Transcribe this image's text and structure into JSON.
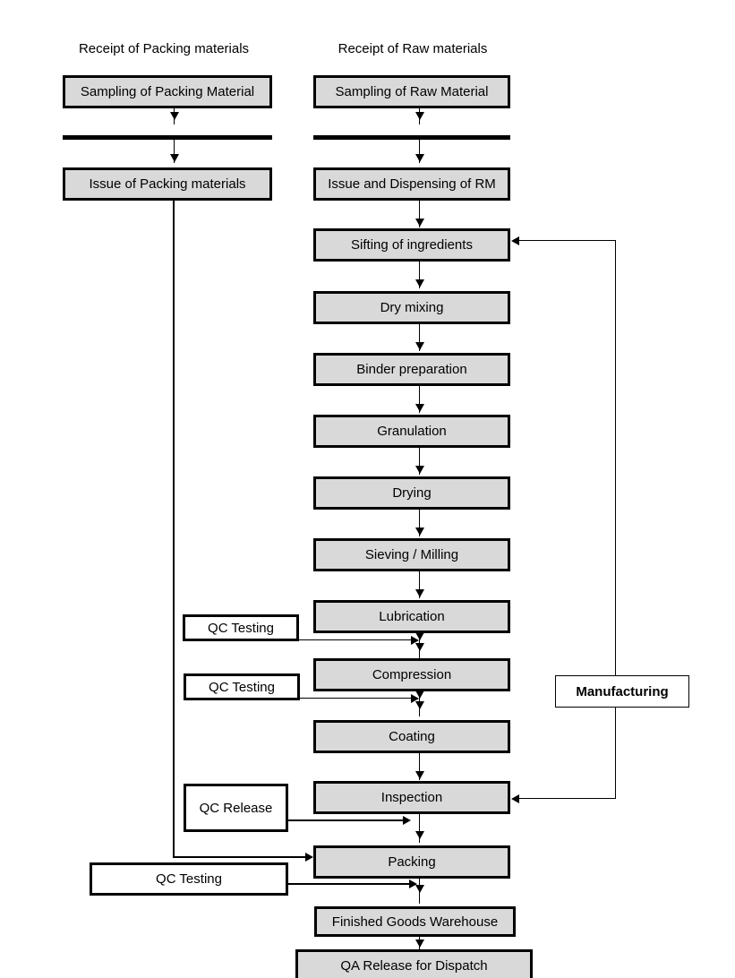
{
  "diagram": {
    "title_left": "Receipt of Packing materials",
    "title_right": "Receipt of Raw materials",
    "side_label": "Manufacturing",
    "colors": {
      "process_fill": "#D9D9D9",
      "qc_fill": "#FFFFFF",
      "stroke": "#000000",
      "background": "#FFFFFF"
    },
    "packing_column": [
      {
        "label": "Sampling of Packing Material"
      },
      {
        "label": "Issue of Packing materials"
      }
    ],
    "raw_column": [
      {
        "label": "Sampling of Raw Material"
      },
      {
        "label": "Issue and Dispensing of RM"
      },
      {
        "label": "Sifting of ingredients"
      },
      {
        "label": "Dry mixing"
      },
      {
        "label": "Binder preparation"
      },
      {
        "label": "Granulation"
      },
      {
        "label": "Drying"
      },
      {
        "label": "Sieving / Milling"
      },
      {
        "label": "Lubrication"
      },
      {
        "label": "Compression"
      },
      {
        "label": "Coating"
      },
      {
        "label": "Inspection"
      },
      {
        "label": "Packing"
      },
      {
        "label": "Finished Goods Warehouse"
      },
      {
        "label": "QA Release for Dispatch"
      }
    ],
    "qc_boxes": [
      {
        "label": "QC Testing",
        "target": "Lubrication"
      },
      {
        "label": "QC Testing",
        "target": "Compression"
      },
      {
        "label": "QC Release",
        "target": "Inspection"
      },
      {
        "label": "QC Testing",
        "target": "Packing"
      }
    ]
  }
}
